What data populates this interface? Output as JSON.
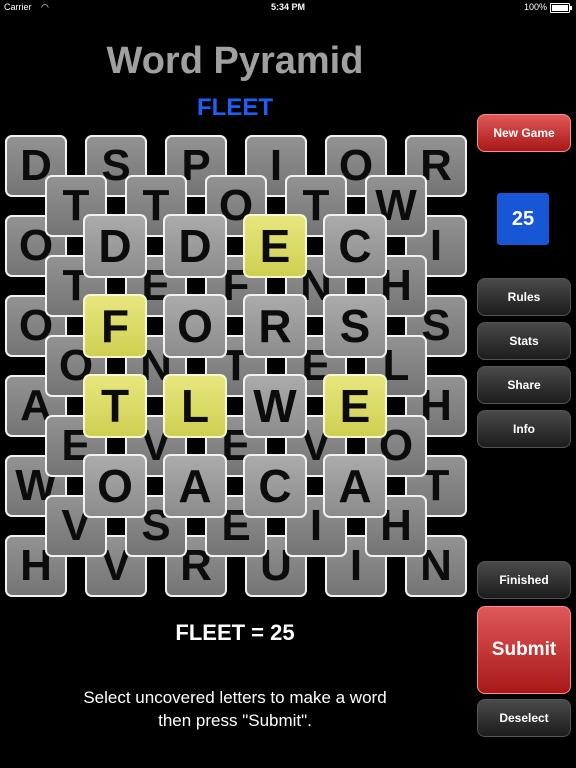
{
  "status_bar": {
    "carrier": "Carrier",
    "time": "5:34 PM",
    "battery": "100%"
  },
  "title": "Word Pyramid",
  "current_word": "FLEET",
  "board": {
    "layers": [
      {
        "rows": [
          [
            "D",
            "S",
            "P",
            "I",
            "O",
            "R"
          ],
          [
            "O",
            "",
            "",
            "",
            "",
            "I"
          ],
          [
            "O",
            "",
            "",
            "",
            "",
            "S"
          ],
          [
            "A",
            "",
            "",
            "",
            "",
            "H"
          ],
          [
            "W",
            "",
            "",
            "",
            "",
            "T"
          ],
          [
            "H",
            "V",
            "R",
            "U",
            "I",
            "N"
          ]
        ]
      },
      {
        "rows": [
          [
            "T",
            "T",
            "O",
            "T",
            "W"
          ],
          [
            "T",
            "E",
            "F",
            "N",
            "H"
          ],
          [
            "O",
            "N",
            "T",
            "E",
            "L"
          ],
          [
            "E",
            "V",
            "E",
            "V",
            "O"
          ],
          [
            "V",
            "S",
            "E",
            "I",
            "H"
          ]
        ]
      },
      {
        "rows": [
          [
            "D",
            "D",
            "E",
            "C"
          ],
          [
            "F",
            "O",
            "R",
            "S"
          ],
          [
            "T",
            "L",
            "W",
            "E"
          ],
          [
            "O",
            "A",
            "C",
            "A"
          ]
        ]
      }
    ],
    "selected": [
      [
        2,
        0,
        2
      ],
      [
        2,
        1,
        0
      ],
      [
        2,
        2,
        0
      ],
      [
        2,
        2,
        1
      ],
      [
        2,
        2,
        3
      ]
    ]
  },
  "buttons": {
    "new_game": "New Game",
    "rules": "Rules",
    "stats": "Stats",
    "share": "Share",
    "info": "Info",
    "finished": "Finished",
    "submit": "Submit",
    "deselect": "Deselect"
  },
  "score": "25",
  "word_score": "FLEET = 25",
  "instructions": {
    "line1": "Select uncovered letters to make a word",
    "line2": "then press \"Submit\"."
  },
  "colors": {
    "accent": "#1e5ff5",
    "selected_tile": "#dede6a",
    "tile": "#9a9a9a",
    "submit": "#c82a2a"
  }
}
